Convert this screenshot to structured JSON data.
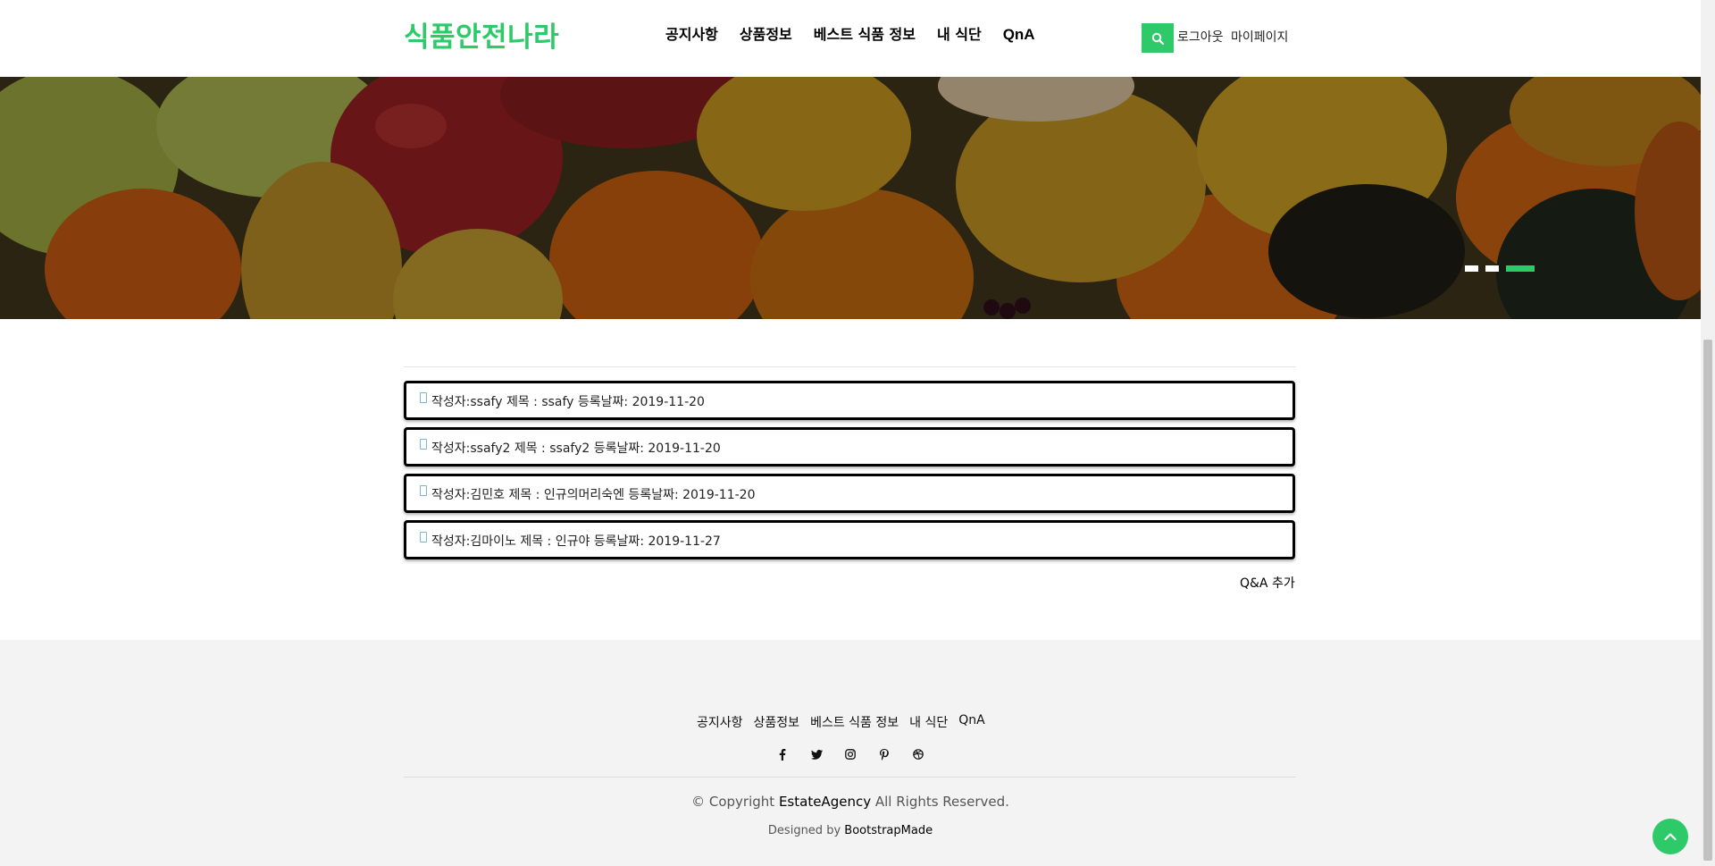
{
  "header": {
    "brand": "식품안전나라",
    "nav": [
      "공지사항",
      "상품정보",
      "베스트 식품 정보",
      "내 식단",
      "QnA"
    ],
    "logout": "로그아웃",
    "mypage": "마이페이지"
  },
  "hero": {
    "indicators": [
      false,
      false,
      true
    ]
  },
  "qna": {
    "items": [
      "작성자:ssafy 제목 : ssafy 등록날짜: 2019-11-20",
      "작성자:ssafy2 제목 : ssafy2 등록날짜: 2019-11-20",
      "작성자:김민호 제목 : 인규의머리숙엔 등록날짜: 2019-11-20",
      "작성자:김마이노 제목 : 인규야 등록날짜: 2019-11-27"
    ],
    "add_label": "Q&A 추가"
  },
  "footer": {
    "nav": [
      "공지사항",
      "상품정보",
      "베스트 식품 정보",
      "내 식단",
      "QnA"
    ],
    "socials": [
      "facebook-icon",
      "twitter-icon",
      "instagram-icon",
      "pinterest-icon",
      "dribbble-icon"
    ],
    "copyright_prefix": "© Copyright",
    "copyright_brand": "EstateAgency",
    "copyright_suffix": "All Rights Reserved.",
    "designed_prefix": "Designed by",
    "designed_brand": "BootstrapMade"
  },
  "colors": {
    "accent": "#2eca6a"
  }
}
